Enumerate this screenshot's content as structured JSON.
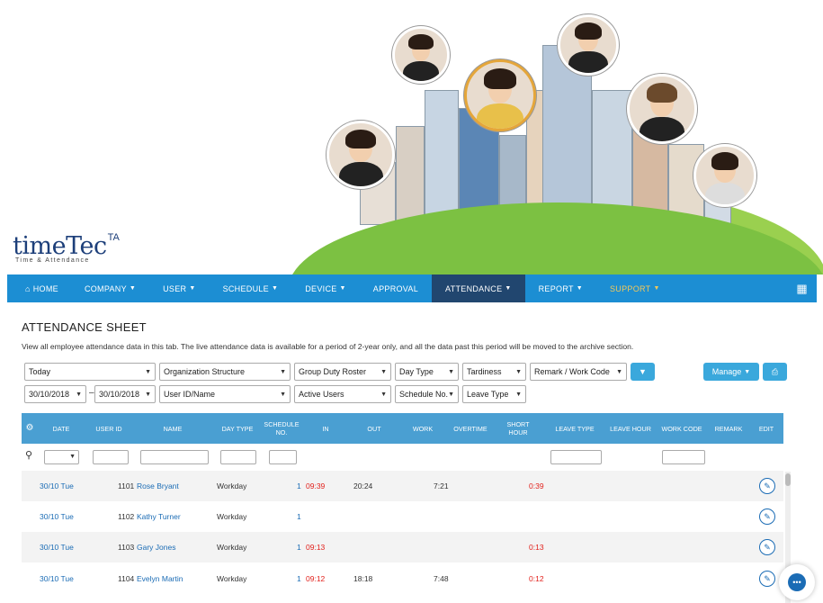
{
  "logo": {
    "main": "timeTec",
    "ta": "TA",
    "sub": "Time & Attendance"
  },
  "nav": {
    "home": "HOME",
    "items": [
      "COMPANY",
      "USER",
      "SCHEDULE",
      "DEVICE",
      "APPROVAL",
      "ATTENDANCE",
      "REPORT",
      "SUPPORT"
    ],
    "active": "ATTENDANCE",
    "icons": {
      "home": "home-icon",
      "apps": "grid-icon"
    }
  },
  "page": {
    "title": "ATTENDANCE SHEET",
    "description": "View all employee attendance data in this tab. The live attendance data is available for a period of 2-year only, and all the data past this period will be moved to the archive section."
  },
  "filters": {
    "period": "Today",
    "org": "Organization Structure",
    "roster": "Group Duty Roster",
    "day_type": "Day Type",
    "tardiness": "Tardiness",
    "remark": "Remark / Work Code",
    "date_from": "30/10/2018",
    "date_sep": "–",
    "date_to": "30/10/2018",
    "user": "User ID/Name",
    "active": "Active Users",
    "schedule": "Schedule No.",
    "leave": "Leave Type",
    "manage": "Manage"
  },
  "table": {
    "headers": {
      "date": "DATE",
      "user_id": "USER ID",
      "name": "NAME",
      "day_type": "DAY TYPE",
      "schedule": "SCHEDULE NO.",
      "in": "IN",
      "out": "OUT",
      "work": "WORK",
      "overtime": "OVERTIME",
      "short": "SHORT HOUR",
      "leave_type": "LEAVE TYPE",
      "leave_hour": "LEAVE HOUR",
      "work_code": "WORK CODE",
      "remark": "REMARK",
      "edit": "EDIT"
    },
    "rows": [
      {
        "date": "30/10 Tue",
        "id": "1101",
        "name": "Rose Bryant",
        "day": "Workday",
        "sch": "1",
        "in": "09:39",
        "out": "20:24",
        "work": "7:21",
        "short": "0:39"
      },
      {
        "date": "30/10 Tue",
        "id": "1102",
        "name": "Kathy Turner",
        "day": "Workday",
        "sch": "1",
        "in": "",
        "out": "",
        "work": "",
        "short": ""
      },
      {
        "date": "30/10 Tue",
        "id": "1103",
        "name": "Gary Jones",
        "day": "Workday",
        "sch": "1",
        "in": "09:13",
        "out": "",
        "work": "",
        "short": "0:13"
      },
      {
        "date": "30/10 Tue",
        "id": "1104",
        "name": "Evelyn Martin",
        "day": "Workday",
        "sch": "1",
        "in": "09:12",
        "out": "18:18",
        "work": "7:48",
        "short": "0:12"
      }
    ]
  }
}
